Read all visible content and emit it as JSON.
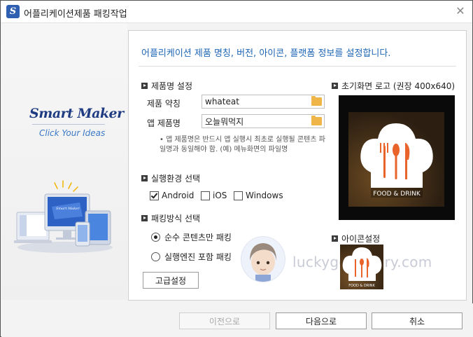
{
  "window": {
    "title": "어플리케이션제품 패킹작업",
    "app_icon": "S",
    "close_symbol": "✕"
  },
  "branding": {
    "logo": "Smart Maker",
    "tagline": "Click Your Ideas"
  },
  "main": {
    "headline": "어플리케이션 제품 명칭, 버전, 아이콘, 플랫폼 정보를 설정합니다.",
    "product_section": {
      "title": "제품명 설정",
      "fields": [
        {
          "label": "제품 약칭",
          "value": "whateat"
        },
        {
          "label": "앱 제품명",
          "value": "오늘뭐먹지"
        }
      ],
      "note": "• 앱 제품명은 반드시 앱 실행시 최초로 실행될 콘텐츠 파일명과 동일해야 함. (예) 메뉴화면의 파일명"
    },
    "env_section": {
      "title": "실행환경 선택",
      "options": [
        {
          "label": "Android",
          "checked": true
        },
        {
          "label": "iOS",
          "checked": false
        },
        {
          "label": "Windows",
          "checked": false
        }
      ]
    },
    "packing_section": {
      "title": "패킹방식 선택",
      "options": [
        {
          "label": "순수 콘텐츠만 패킹",
          "checked": true
        },
        {
          "label": "실행엔진 포함 패킹",
          "checked": false
        }
      ]
    },
    "advanced_button": "고급설정",
    "splash": {
      "title": "초기화면 로고 (권장 400x640)",
      "image_text": "FOOD & DRINK"
    },
    "icon_setting": {
      "title": "아이콘설정",
      "image_text": "FOOD & DRINK"
    },
    "watermark": "luckygg.tistory.com"
  },
  "footer": {
    "prev": "이전으로",
    "next": "다음으로",
    "cancel": "취소"
  },
  "colors": {
    "accent": "#1e66b6",
    "food_orange": "#e8642a"
  }
}
